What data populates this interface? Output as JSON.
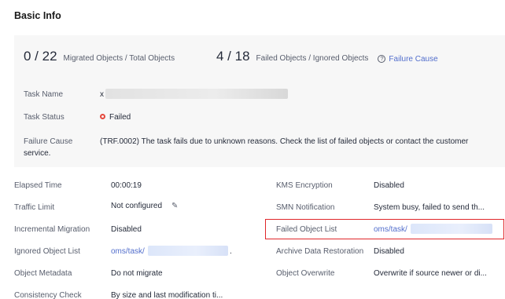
{
  "section_title": "Basic Info",
  "stats": {
    "migrated": {
      "value": "0 / 22",
      "label": "Migrated Objects / Total Objects"
    },
    "failed": {
      "value": "4 / 18",
      "label": "Failed Objects / Ignored Objects"
    },
    "failure_cause_link": "Failure Cause",
    "failure_cause_icon": "question-circle-icon"
  },
  "summary": {
    "task_name": {
      "label": "Task Name",
      "value": "x"
    },
    "task_status": {
      "label": "Task Status",
      "value": "Failed",
      "status_color": "#e5483c"
    },
    "failure_cause": {
      "label": "Failure Cause",
      "value": "(TRF.0002) The task fails due to unknown reasons. Check the list of failed objects or contact the customer",
      "continuation": "service."
    }
  },
  "details_left": [
    {
      "label": "Elapsed Time",
      "value": "00:00:19"
    },
    {
      "label": "Traffic Limit",
      "value": "Not configured",
      "icon": "pencil-icon"
    },
    {
      "label": "Incremental Migration",
      "value": "Disabled"
    },
    {
      "label": "Ignored Object List",
      "value": "oms/task/",
      "suffix": "."
    },
    {
      "label": "Object Metadata",
      "value": "Do not migrate"
    },
    {
      "label": "Consistency Check",
      "value": "By size and last modification ti..."
    }
  ],
  "details_right": [
    {
      "label": "KMS Encryption",
      "value": "Disabled"
    },
    {
      "label": "SMN Notification",
      "value": "System busy, failed to send th..."
    },
    {
      "label": "Failed Object List",
      "value": "oms/task/"
    },
    {
      "label": "Archive Data Restoration",
      "value": "Disabled"
    },
    {
      "label": "Object Overwrite",
      "value": "Overwrite if source newer or di..."
    }
  ],
  "colors": {
    "link": "#526ecc",
    "highlight": "#e0262a",
    "summary_bg": "#f7f7f7"
  }
}
